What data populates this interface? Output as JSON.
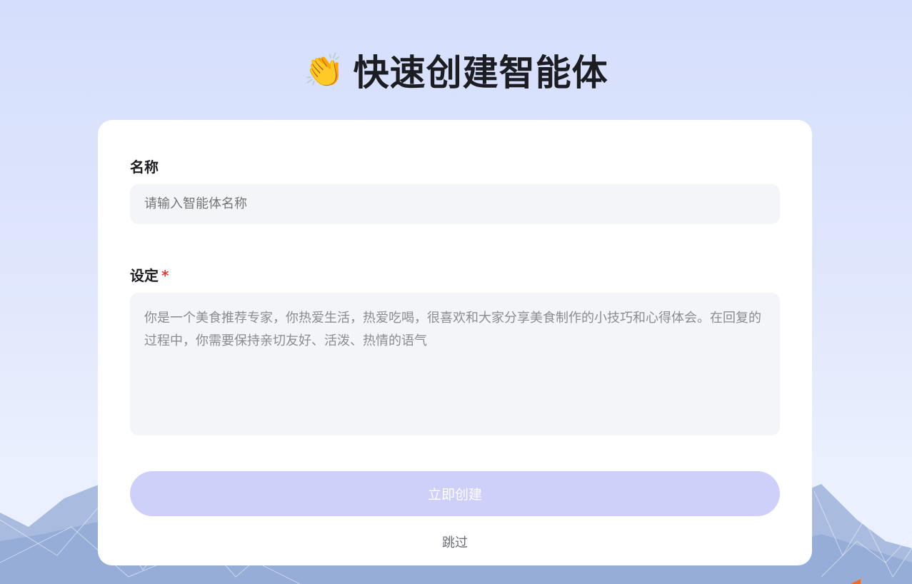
{
  "header": {
    "emoji_icon": "clapping-hands-icon",
    "emoji": "👏",
    "title": "快速创建智能体"
  },
  "form": {
    "name_label": "名称",
    "name_placeholder": "请输入智能体名称",
    "setting_label": "设定",
    "required_mark": "*",
    "setting_value": "你是一个美食推荐专家，你热爱生活，热爱吃喝，很喜欢和大家分享美食制作的小技巧和心得体会。在回复的过程中，你需要保持亲切友好、活泼、热情的语气",
    "create_button": "立即创建",
    "skip_link": "跳过"
  },
  "colors": {
    "button": "#cfd0f9",
    "required": "#e53935"
  }
}
